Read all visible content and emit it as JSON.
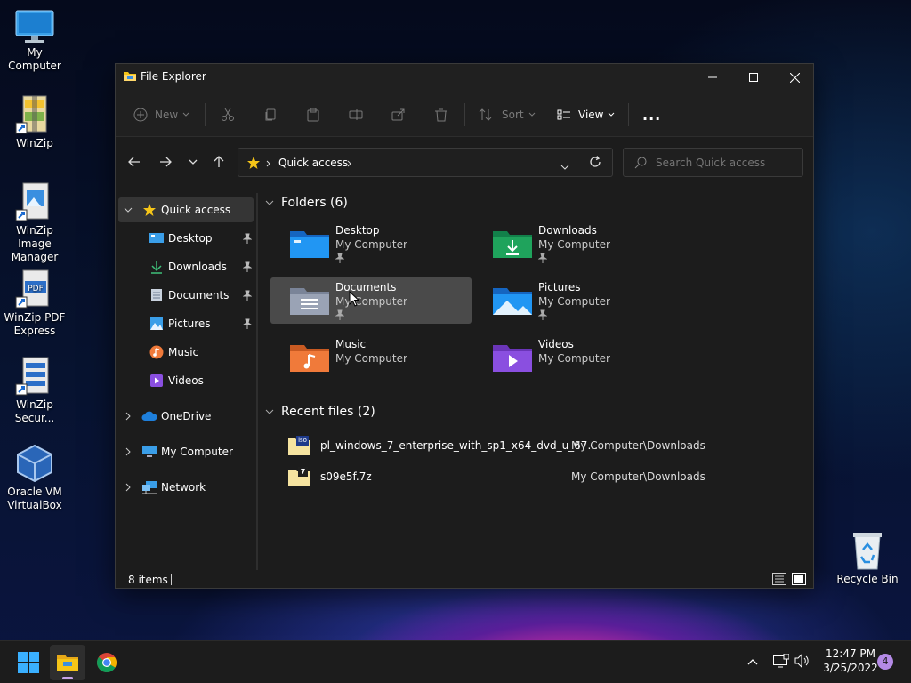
{
  "desktop": {
    "icons": [
      {
        "label": "My Computer"
      },
      {
        "label": "WinZip"
      },
      {
        "label": "WinZip Image Manager"
      },
      {
        "label": "WinZip PDF Express"
      },
      {
        "label": "WinZip Secur..."
      },
      {
        "label": "Oracle VM VirtualBox"
      },
      {
        "label": "Recycle Bin"
      }
    ]
  },
  "window": {
    "title": "File Explorer",
    "toolbar": {
      "new": "New",
      "sort": "Sort",
      "view": "View",
      "more": "..."
    },
    "address": {
      "location": "Quick access"
    },
    "search": {
      "placeholder": "Search Quick access"
    },
    "nav_pane": {
      "items": [
        {
          "label": "Quick access"
        },
        {
          "label": "Desktop"
        },
        {
          "label": "Downloads"
        },
        {
          "label": "Documents"
        },
        {
          "label": "Pictures"
        },
        {
          "label": "Music"
        },
        {
          "label": "Videos"
        },
        {
          "label": "OneDrive"
        },
        {
          "label": "My Computer"
        },
        {
          "label": "Network"
        }
      ]
    },
    "folders": {
      "header": "Folders (6)",
      "items": [
        {
          "name": "Desktop",
          "location": "My Computer"
        },
        {
          "name": "Downloads",
          "location": "My Computer"
        },
        {
          "name": "Documents",
          "location": "My Computer"
        },
        {
          "name": "Pictures",
          "location": "My Computer"
        },
        {
          "name": "Music",
          "location": "My Computer"
        },
        {
          "name": "Videos",
          "location": "My Computer"
        }
      ]
    },
    "recent": {
      "header": "Recent files (2)",
      "items": [
        {
          "name": "pl_windows_7_enterprise_with_sp1_x64_dvd_u_67...",
          "location": "My Computer\\Downloads",
          "badge": "iso"
        },
        {
          "name": "s09e5f.7z",
          "location": "My Computer\\Downloads",
          "badge": "7"
        }
      ]
    },
    "status": {
      "count": "8 items"
    }
  },
  "taskbar": {
    "time": "12:47 PM",
    "date": "3/25/2022",
    "notification_count": "4"
  },
  "colors": {
    "accent_blue": "#4cc2ff",
    "folder_blue": "#1e88e5",
    "folder_green": "#1fa35c",
    "folder_gray": "#9aa3b5",
    "folder_orange": "#f07a3a",
    "folder_purple": "#8a4fe0",
    "star_yellow": "#f5c518",
    "badge_purple": "#b48ae6"
  }
}
